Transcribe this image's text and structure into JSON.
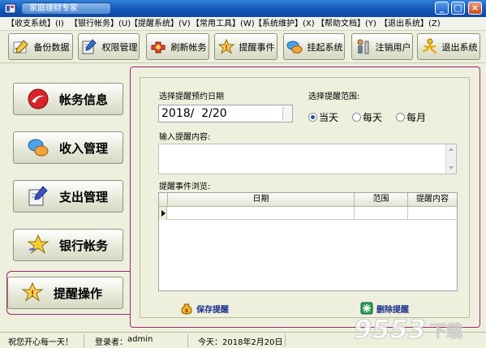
{
  "window": {
    "title": "家庭理财专家",
    "minimize": "_",
    "maximize": "□",
    "close": "×"
  },
  "menu": [
    {
      "label": "【收支系统】(I)"
    },
    {
      "label": "【银行帐务】(U)"
    },
    {
      "label": "【提醒系统】(V)"
    },
    {
      "label": "【常用工具】(W)"
    },
    {
      "label": "【系统维护】(X)"
    },
    {
      "label": "【帮助文档】(Y)"
    },
    {
      "label": "【退出系统】(Z)"
    }
  ],
  "toolbar": [
    {
      "label": "备份数据",
      "icon": "pencil-check-icon"
    },
    {
      "label": "权限管理",
      "icon": "pencil-note-icon"
    },
    {
      "label": "刷新帐务",
      "icon": "refresh-puzzle-icon"
    },
    {
      "label": "提醒事件",
      "icon": "alert-star-icon"
    },
    {
      "label": "挂起系统",
      "icon": "chat-bubbles-icon"
    },
    {
      "label": "注销用户",
      "icon": "user-logout-icon"
    },
    {
      "label": "退出系统",
      "icon": "running-man-icon"
    }
  ],
  "nav": [
    {
      "label": "帐务信息",
      "icon": "red-swoosh-icon",
      "active": false
    },
    {
      "label": "收入管理",
      "icon": "chat-bubbles-icon",
      "active": false
    },
    {
      "label": "支出管理",
      "icon": "pencil-note-icon",
      "active": false
    },
    {
      "label": "银行帐务",
      "icon": "star-icon",
      "active": false
    },
    {
      "label": "提醒操作",
      "icon": "alert-star-icon",
      "active": true
    }
  ],
  "panel": {
    "date_label": "选择提醒预约日期",
    "date_value": "2018/  2/20",
    "range_label": "选择提醒范围:",
    "range_options": [
      {
        "label": "当天",
        "selected": true
      },
      {
        "label": "每天",
        "selected": false
      },
      {
        "label": "每月",
        "selected": false
      }
    ],
    "content_label": "输入提醒内容:",
    "content_value": "",
    "browse_label": "提醒事件浏览:",
    "grid_columns": [
      "日期",
      "范围",
      "提醒内容"
    ],
    "grid_rows": [],
    "save_label": "保存提醒",
    "delete_label": "删除提醒"
  },
  "status": {
    "greeting": "祝您开心每一天！",
    "user_label": "登录者：",
    "user": "admin",
    "today": "今天：2018年2月20日"
  },
  "watermark": {
    "text": "9553下载"
  },
  "colors": {
    "accent_border": "#a0226f",
    "titlebar": "#1556b9",
    "background": "#eef0dd",
    "action_text": "#1d2f8c"
  }
}
